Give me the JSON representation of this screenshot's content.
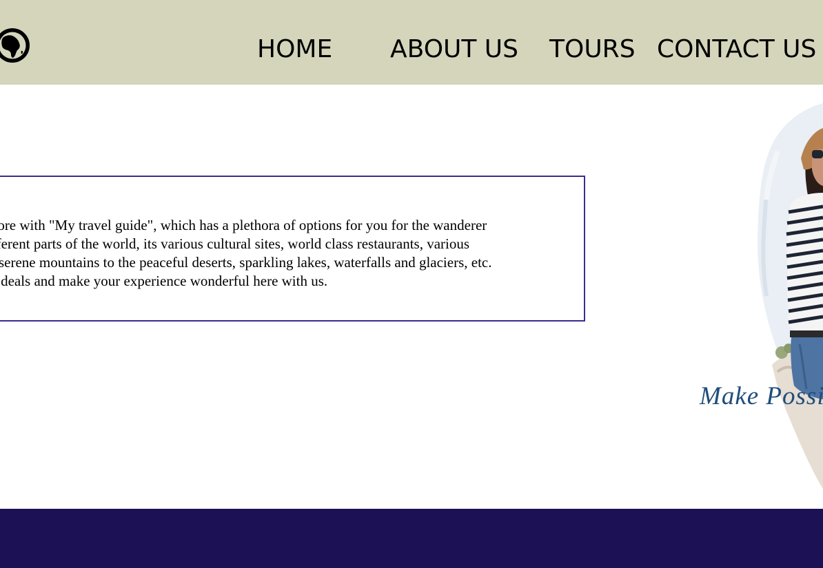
{
  "header": {
    "logo_icon": "globe-africa-icon",
    "background": "#d4d5bb",
    "nav": [
      {
        "label": "HOME"
      },
      {
        "label": "ABOUT US"
      },
      {
        "label": "TOURS"
      },
      {
        "label": "CONTACT US"
      }
    ]
  },
  "intro": {
    "border_color": "#3c2a8e",
    "lines": [
      "efore with \"My travel guide\", which has a plethora of options for you for the wanderer",
      "fferent parts of the world, its various cultural sites, world class restaurants, various",
      "serene mountains to the peaceful deserts, sparkling lakes, waterfalls and glaciers, etc.",
      "t deals and make your experience wonderful here with us."
    ]
  },
  "hero": {
    "tagline": "Make Possi",
    "tagline_color": "#1f4d7a"
  },
  "footer": {
    "background": "#1c1155"
  }
}
